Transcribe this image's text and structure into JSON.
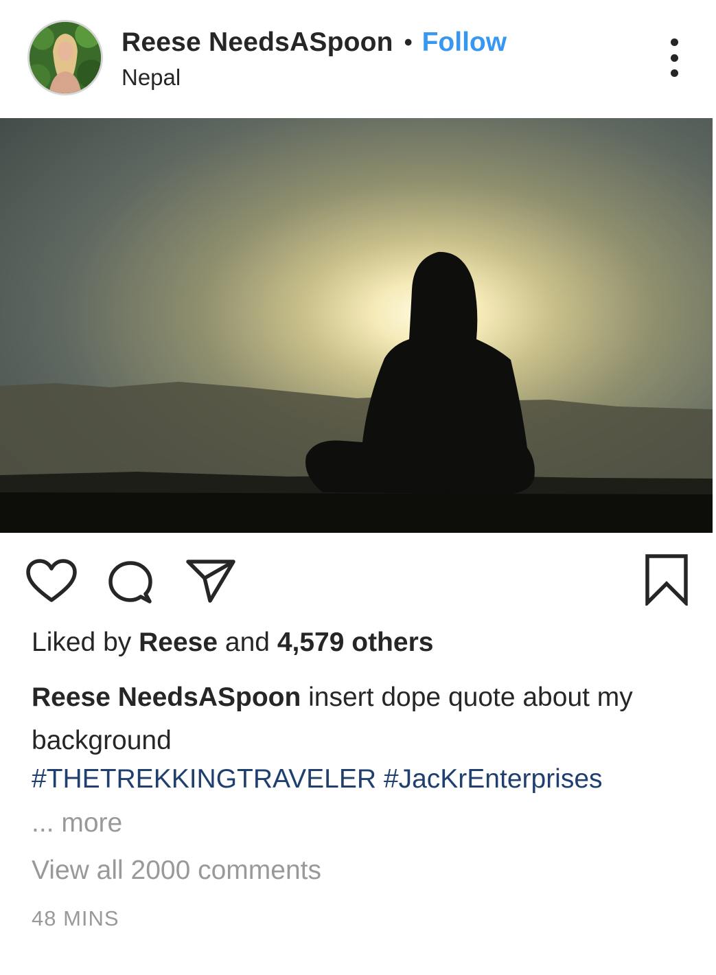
{
  "post": {
    "username": "Reese NeedsASpoon",
    "separator": "•",
    "follow_label": "Follow",
    "location": "Nepal",
    "likes": {
      "prefix": "Liked by",
      "liker": "Reese",
      "connector": "and",
      "count_text": "4,579 others"
    },
    "caption": {
      "username": "Reese NeedsASpoon",
      "text": "insert dope quote about my background"
    },
    "hashtags": [
      "#THETREKKINGTRAVELER",
      "#JacKrEnterprises"
    ],
    "more_label": "... more",
    "view_comments_label": "View all 2000 comments",
    "timestamp": "48 MINS"
  },
  "icons": {
    "more": "more-options-icon",
    "like": "heart-icon",
    "comment": "comment-bubble-icon",
    "share": "paper-plane-icon",
    "save": "bookmark-icon"
  },
  "colors": {
    "follow": "#3897f0",
    "text": "#262626",
    "hashtag": "#1f3f6f",
    "muted": "#999999"
  }
}
